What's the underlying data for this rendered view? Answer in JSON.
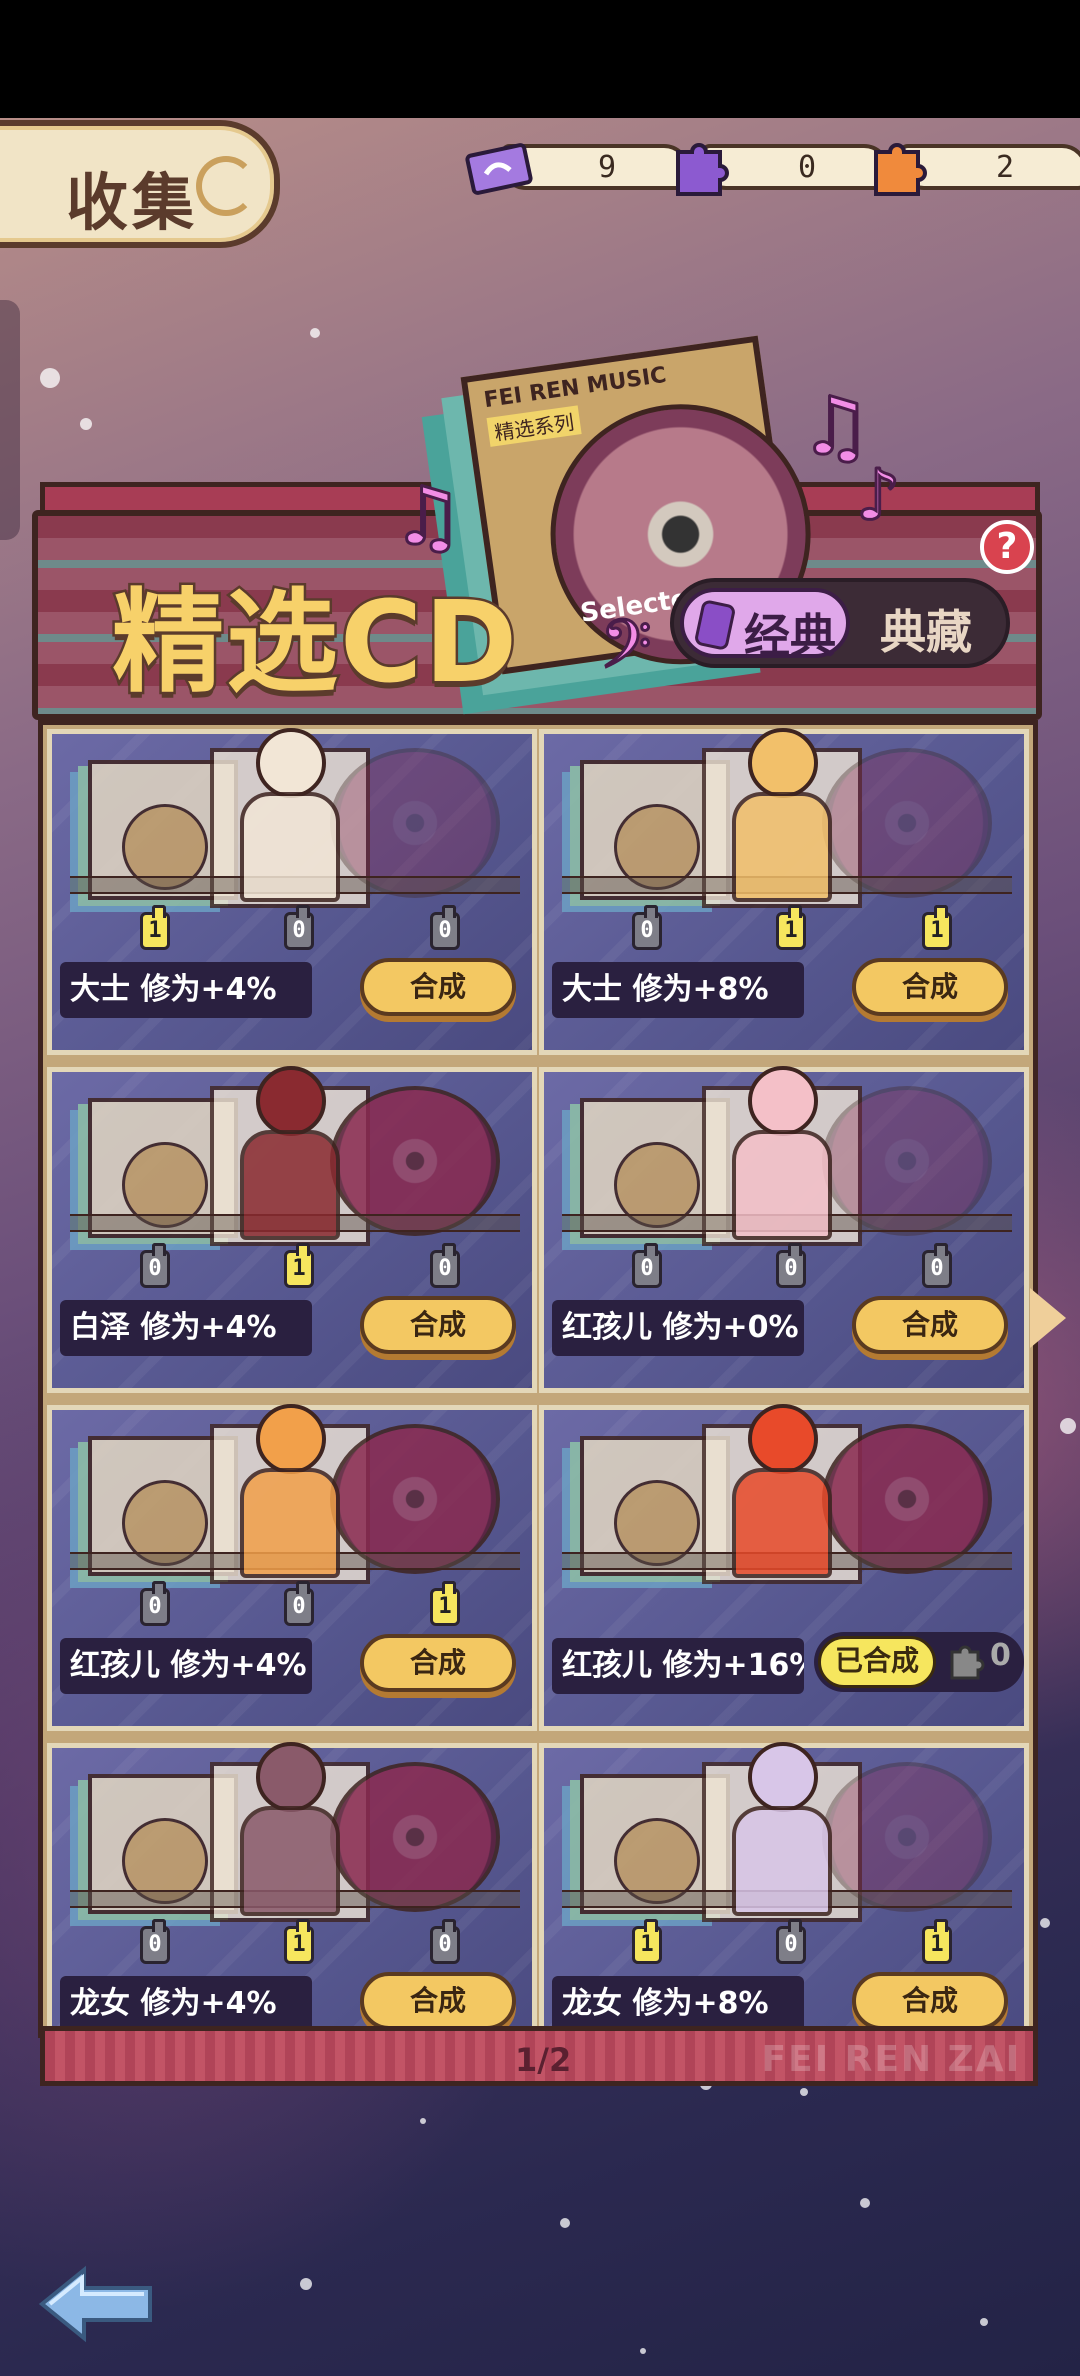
{
  "page": {
    "title": "收集"
  },
  "currency": [
    {
      "icon": "purple-ticket-icon",
      "value": "9"
    },
    {
      "icon": "purple-puzzle-icon",
      "value": "0"
    },
    {
      "icon": "orange-puzzle-icon",
      "value": "2"
    }
  ],
  "header": {
    "title": "精选CD",
    "cd_case_header": "FEI REN MUSIC",
    "cd_case_sub": "精选系列",
    "cd_case_caption": "Selected",
    "toggle_active": "经典",
    "toggle_inactive": "典藏",
    "help": "?"
  },
  "cards": [
    {
      "slots": [
        "1",
        "0",
        "0"
      ],
      "label": "大士  修为+4%",
      "action": "合成"
    },
    {
      "slots": [
        "0",
        "1",
        "1"
      ],
      "label": "大士  修为+8%",
      "action": "合成"
    },
    {
      "slots": [
        "0",
        "1",
        "0"
      ],
      "label": "白泽  修为+4%",
      "action": "合成"
    },
    {
      "slots": [
        "0",
        "0",
        "0"
      ],
      "label": "红孩儿 修为+0%",
      "action": "合成"
    },
    {
      "slots": [
        "0",
        "0",
        "1"
      ],
      "label": "红孩儿 修为+4%",
      "action": "合成"
    },
    {
      "slots": [],
      "label": "红孩儿 修为+16%",
      "status": "已合成",
      "fragments": "0"
    },
    {
      "slots": [
        "0",
        "1",
        "0"
      ],
      "label": "龙女  修为+4%",
      "action": "合成"
    },
    {
      "slots": [
        "1",
        "0",
        "1"
      ],
      "label": "龙女  修为+8%",
      "action": "合成"
    }
  ],
  "footer": {
    "page": "1/2",
    "brand": "FEI REN ZAI"
  }
}
